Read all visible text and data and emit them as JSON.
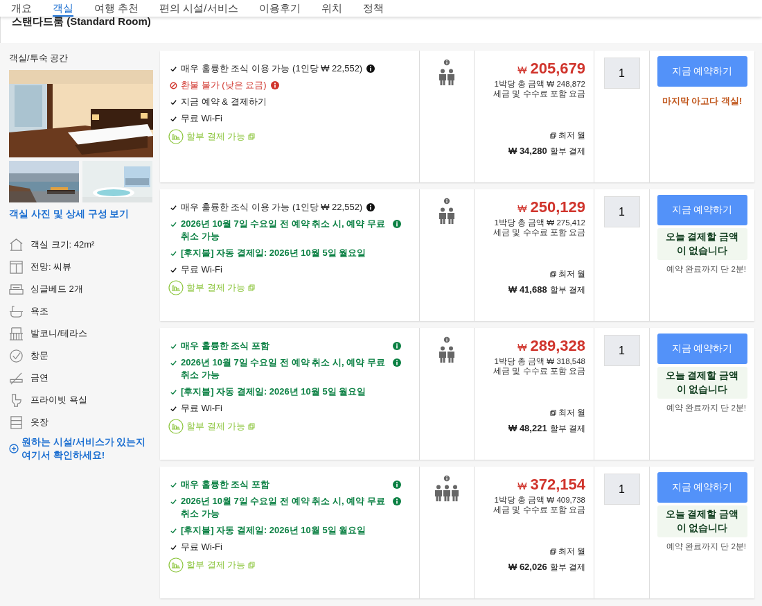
{
  "nav": {
    "tabs": [
      {
        "label": "개요",
        "selected": false
      },
      {
        "label": "객실",
        "selected": true
      },
      {
        "label": "여행 추천",
        "selected": false
      },
      {
        "label": "편의 시설/서비스",
        "selected": false
      },
      {
        "label": "이용후기",
        "selected": false
      },
      {
        "label": "위치",
        "selected": false
      },
      {
        "label": "정책",
        "selected": false
      }
    ]
  },
  "room": {
    "title": "스탠다드룸 (Standard Room)",
    "side": {
      "heading": "객실/투숙 공간",
      "photos_link": "객실 사진 및 상세 구성 보기",
      "amenities": [
        {
          "kind": "house",
          "label": "객실 크기: 42m²"
        },
        {
          "kind": "window",
          "label": "전망: 씨뷰"
        },
        {
          "kind": "bed",
          "label": "싱글베드 2개"
        },
        {
          "kind": "bath",
          "label": "욕조"
        },
        {
          "kind": "balcony",
          "label": "발코니/테라스"
        },
        {
          "kind": "check",
          "label": "창문"
        },
        {
          "kind": "nosmoking",
          "label": "금연"
        },
        {
          "kind": "toilet",
          "label": "프라이빗 욕실"
        },
        {
          "kind": "wardrobe",
          "label": "옷장"
        }
      ],
      "ask_link": "원하는 시설/서비스가 있는지 여기서 확인하세요!"
    },
    "offers": [
      {
        "features": [
          {
            "kind": "plain",
            "text": "매우 훌륭한 조식 이용 가능 (1인당 ₩ 22,552)",
            "info": true
          },
          {
            "kind": "red",
            "text": "환불 불가 (낮은 요금)",
            "info": true
          },
          {
            "kind": "plain",
            "text": "지금 예약 & 결제하기",
            "info": false
          },
          {
            "kind": "plain",
            "text": "무료 Wi-Fi",
            "info": false
          }
        ],
        "installment": "할부 결제 가능",
        "guests": [
          {
            "kind": "adult"
          },
          {
            "kind": "adult"
          }
        ],
        "currency": "₩",
        "price": "205,679",
        "total": "1박당 총 금액 ₩ 248,872",
        "tax_note": "세금 및 수수료 포함 요금",
        "monthly_label": "최저 월",
        "monthly_amount": "₩ 34,280",
        "monthly_suffix": "할부 결제",
        "quantity": "1",
        "button": "지금 예약하기",
        "notes": [
          {
            "kind": "urgent",
            "text": "마지막 아고다 객실!"
          }
        ]
      },
      {
        "features": [
          {
            "kind": "plain",
            "text": "매우 훌륭한 조식 이용 가능 (1인당 ₩ 22,552)",
            "info": true
          },
          {
            "kind": "green",
            "text": "2026년 10월 7일 수요일 전 예약 취소 시, 예약 무료 취소 가능",
            "info": true
          },
          {
            "kind": "green",
            "text": "[후지불] 자동 결제일: 2026년 10월 5일 월요일",
            "info": false
          },
          {
            "kind": "plain",
            "text": "무료 Wi-Fi",
            "info": false
          }
        ],
        "installment": "할부 결제 가능",
        "guests": [
          {
            "kind": "adult"
          },
          {
            "kind": "adult"
          }
        ],
        "currency": "₩",
        "price": "250,129",
        "total": "1박당 총 금액 ₩ 275,412",
        "tax_note": "세금 및 수수료 포함 요금",
        "monthly_label": "최저 월",
        "monthly_amount": "₩ 41,688",
        "monthly_suffix": "할부 결제",
        "quantity": "1",
        "button": "지금 예약하기",
        "notes": [
          {
            "kind": "pay-later",
            "text": "오늘 결제할 금액이 없습니다"
          },
          {
            "kind": "hint",
            "text": "예약 완료까지 단 2분!"
          }
        ]
      },
      {
        "features": [
          {
            "kind": "green",
            "text": "매우 훌륭한 조식 포함",
            "info": true
          },
          {
            "kind": "green",
            "text": "2026년 10월 7일 수요일 전 예약 취소 시, 예약 무료 취소 가능",
            "info": true
          },
          {
            "kind": "green",
            "text": "[후지불] 자동 결제일: 2026년 10월 5일 월요일",
            "info": false
          },
          {
            "kind": "plain",
            "text": "무료 Wi-Fi",
            "info": false
          }
        ],
        "installment": "할부 결제 가능",
        "guests": [
          {
            "kind": "adult"
          },
          {
            "kind": "adult"
          }
        ],
        "currency": "₩",
        "price": "289,328",
        "total": "1박당 총 금액 ₩ 318,548",
        "tax_note": "세금 및 수수료 포함 요금",
        "monthly_label": "최저 월",
        "monthly_amount": "₩ 48,221",
        "monthly_suffix": "할부 결제",
        "quantity": "1",
        "button": "지금 예약하기",
        "notes": [
          {
            "kind": "pay-later",
            "text": "오늘 결제할 금액이 없습니다"
          },
          {
            "kind": "hint",
            "text": "예약 완료까지 단 2분!"
          }
        ]
      },
      {
        "features": [
          {
            "kind": "green",
            "text": "매우 훌륭한 조식 포함",
            "info": true
          },
          {
            "kind": "green",
            "text": "2026년 10월 7일 수요일 전 예약 취소 시, 예약 무료 취소 가능",
            "info": true
          },
          {
            "kind": "green",
            "text": "[후지불] 자동 결제일: 2026년 10월 5일 월요일",
            "info": false
          },
          {
            "kind": "plain",
            "text": "무료 Wi-Fi",
            "info": false
          }
        ],
        "installment": "할부 결제 가능",
        "guests": [
          {
            "kind": "adult"
          },
          {
            "kind": "adult"
          },
          {
            "kind": "adult"
          }
        ],
        "currency": "₩",
        "price": "372,154",
        "total": "1박당 총 금액 ₩ 409,738",
        "tax_note": "세금 및 수수료 포함 요금",
        "monthly_label": "최저 월",
        "monthly_amount": "₩ 62,026",
        "monthly_suffix": "할부 결제",
        "quantity": "1",
        "button": "지금 예약하기",
        "notes": [
          {
            "kind": "pay-later",
            "text": "오늘 결제할 금액이 없습니다"
          },
          {
            "kind": "hint",
            "text": "예약 완료까지 단 2분!"
          }
        ]
      }
    ]
  }
}
